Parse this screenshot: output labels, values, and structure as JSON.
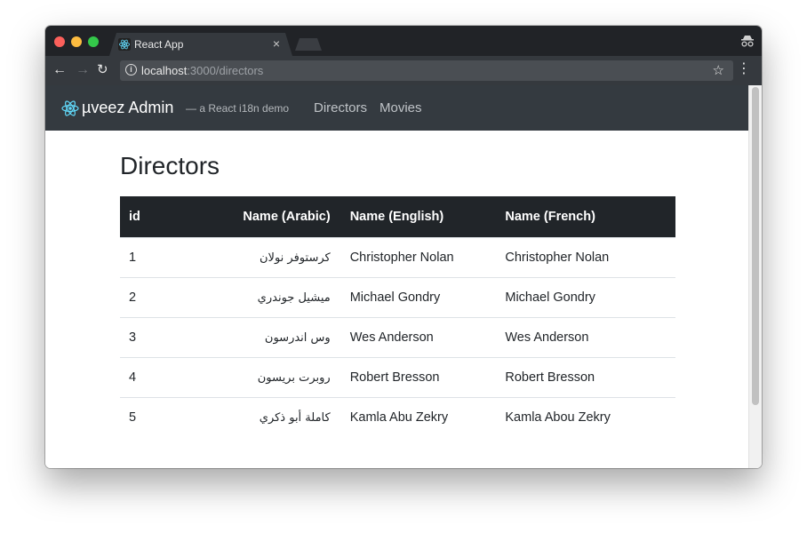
{
  "browser": {
    "tab_title": "React App",
    "tab_close": "×",
    "url_host": "localhost",
    "url_path": ":3000/directors",
    "icons": [
      "react-favicon-icon",
      "close-icon",
      "incognito-icon",
      "back-arrow-icon",
      "forward-arrow-icon",
      "reload-icon",
      "info-icon",
      "star-icon",
      "more-vert-icon"
    ]
  },
  "navbar": {
    "brand": "µveez Admin",
    "tagline": "— a React i18n demo",
    "links": [
      "Directors",
      "Movies"
    ],
    "bg_color": "#343a40"
  },
  "main": {
    "title": "Directors",
    "table": {
      "headers": [
        "id",
        "Name (Arabic)",
        "Name (English)",
        "Name (French)"
      ],
      "rows": [
        [
          "1",
          "كرستوفر نولان",
          "Christopher Nolan",
          "Christopher Nolan"
        ],
        [
          "2",
          "ميشيل جوندري",
          "Michael Gondry",
          "Michael Gondry"
        ],
        [
          "3",
          "وس اندرسون",
          "Wes Anderson",
          "Wes Anderson"
        ],
        [
          "4",
          "روبرت بريسون",
          "Robert Bresson",
          "Robert Bresson"
        ],
        [
          "5",
          "كاملة أبو ذكري",
          "Kamla Abu Zekry",
          "Kamla Abou Zekry"
        ]
      ]
    }
  }
}
